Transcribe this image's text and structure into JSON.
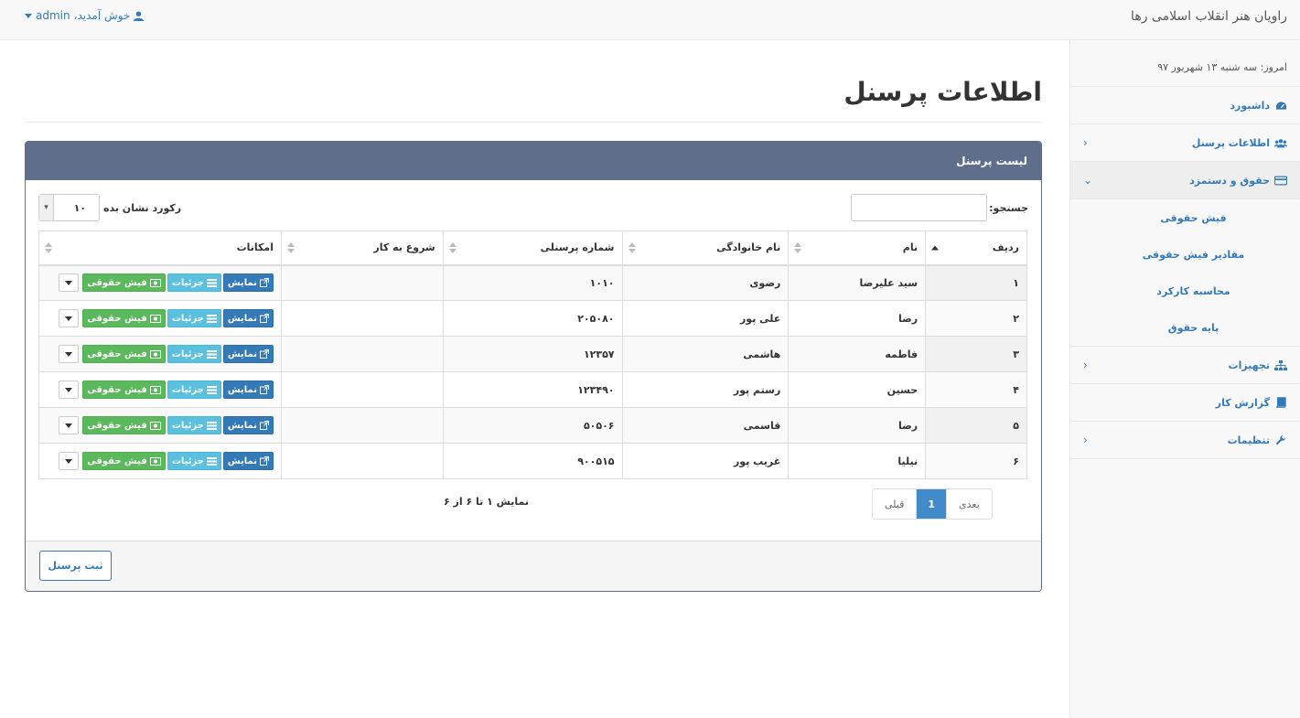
{
  "header": {
    "brand": "راویان هنر انقلاب اسلامی رها",
    "welcome": "خوش آمدید،",
    "username": "admin"
  },
  "sidebar": {
    "date_label": "امروز:",
    "date_value": "سه شنبه ۱۳ شهریور ۹۷",
    "items": [
      {
        "label": "داشبورد",
        "icon": "dashboard-icon"
      },
      {
        "label": "اطلاعات پرسنل",
        "icon": "users-icon"
      },
      {
        "label": "حقوق و دستمزد",
        "icon": "credit-card-icon"
      },
      {
        "label": "تجهیزات",
        "icon": "sitemap-icon"
      },
      {
        "label": "گزارش کار",
        "icon": "book-icon"
      },
      {
        "label": "تنظیمات",
        "icon": "wrench-icon"
      }
    ],
    "subitems": [
      {
        "label": "فیش حقوقی"
      },
      {
        "label": "مقادیر فیش حقوقی"
      },
      {
        "label": "محاسبه کارکرد"
      },
      {
        "label": "پایه حقوق"
      }
    ]
  },
  "page": {
    "title": "اطلاعات پرسنل",
    "panel_title": "لیست پرسنل",
    "search_label": "جستجو:",
    "length_label": "رکورد نشان بده",
    "length_value": "۱۰",
    "info": "نمایش ۱ تا ۶ از ۶",
    "add_button": "ثبت پرسنل"
  },
  "table": {
    "headers": [
      "ردیف",
      "نام",
      "نام خانوادگی",
      "شماره پرسنلی",
      "شروع به کار",
      "امکانات"
    ],
    "rows": [
      {
        "idx": "۱",
        "name": "سید علیرضا",
        "family": "رضوی",
        "code": "۱۰۱۰",
        "start": ""
      },
      {
        "idx": "۲",
        "name": "رضا",
        "family": "علی پور",
        "code": "۲۰۵۰۸۰",
        "start": ""
      },
      {
        "idx": "۳",
        "name": "فاطمه",
        "family": "هاشمی",
        "code": "۱۲۳۵۷",
        "start": ""
      },
      {
        "idx": "۴",
        "name": "حسین",
        "family": "رستم پور",
        "code": "۱۲۳۴۹۰",
        "start": ""
      },
      {
        "idx": "۵",
        "name": "رضا",
        "family": "قاسمی",
        "code": "۵۰۵۰۶",
        "start": ""
      },
      {
        "idx": "۶",
        "name": "نیلیا",
        "family": "غریب پور",
        "code": "۹۰۰۵۱۵",
        "start": ""
      }
    ],
    "action_show": "نمایش",
    "action_detail": "جزئیات",
    "action_fish": "فیش حقوقی"
  },
  "pagination": {
    "prev": "قبلی",
    "current": "1",
    "next": "بعدی"
  },
  "colors": {
    "primary": "#337ab7",
    "panel_heading": "#5f6e8a",
    "info": "#5bc0de",
    "success": "#5cb85c"
  }
}
